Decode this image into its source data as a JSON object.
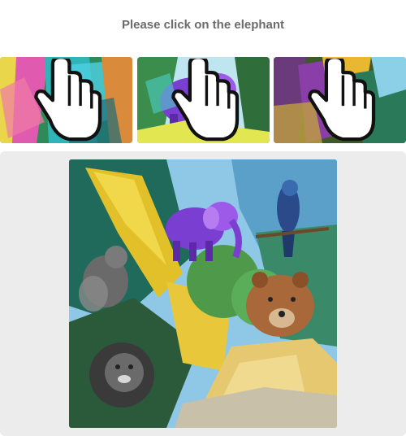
{
  "prompt": {
    "text": "Please click on the elephant"
  },
  "thumbnails": [
    {
      "name": "thumbnail-1",
      "cursor_icon": "hand-pointer-icon"
    },
    {
      "name": "thumbnail-2",
      "cursor_icon": "hand-pointer-icon"
    },
    {
      "name": "thumbnail-3",
      "cursor_icon": "hand-pointer-icon"
    }
  ],
  "scene": {
    "animals": [
      "elephant",
      "squirrel",
      "lion",
      "bear",
      "parrot"
    ]
  },
  "colors": {
    "panel_bg": "#ececec",
    "prompt_text": "#6b6b6b"
  }
}
